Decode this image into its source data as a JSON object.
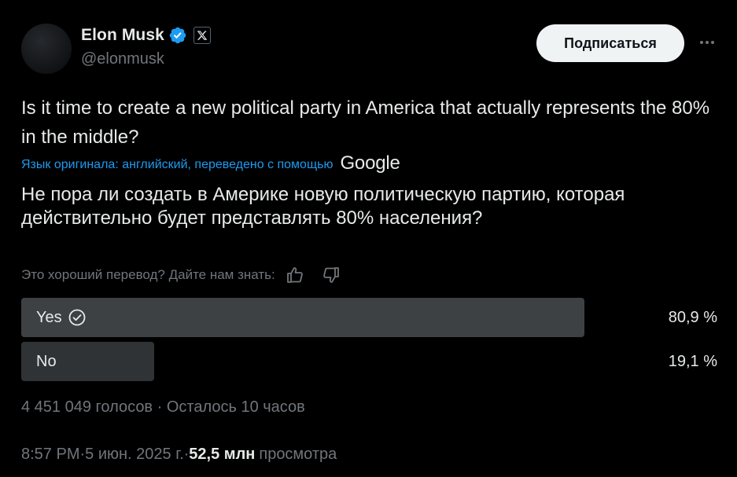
{
  "author": {
    "name": "Elon Musk",
    "handle": "@elonmusk",
    "avatar_icon": "avatar-dark-circle",
    "verified_color": "#1d9bf0"
  },
  "header": {
    "subscribe_label": "Подписаться",
    "more_icon": "ellipsis-icon"
  },
  "tweet": {
    "text": "Is it time to create a new political party in America that actually represents the 80% in the middle?",
    "translation_source": "Язык оригинала: английский, переведено с помощью",
    "translation_provider": "Google",
    "translated_text": "Не пора ли создать в Америке новую политическую партию, которая действительно будет представлять 80% населения?",
    "feedback_prompt": "Это хороший перевод? Дайте нам знать:"
  },
  "poll": {
    "options": [
      {
        "label": "Yes",
        "percent_text": "80,9 %",
        "fraction": 0.809,
        "winner": true
      },
      {
        "label": "No",
        "percent_text": "19,1 %",
        "fraction": 0.191,
        "winner": false
      }
    ],
    "votes_text": "4 451 049 голосов",
    "separator": " · ",
    "remaining_text": "Осталось 10 часов"
  },
  "footer": {
    "time": "8:57 PM",
    "separator": " · ",
    "date": "5 июн. 2025 г.",
    "views_count": "52,5 млн",
    "views_label": "просмотра"
  },
  "colors": {
    "background": "#000000",
    "text": "#e7e9ea",
    "secondary": "#71767b",
    "accent": "#1d9bf0",
    "winner_bar": "#3e4144",
    "loser_bar": "#2f3336"
  }
}
